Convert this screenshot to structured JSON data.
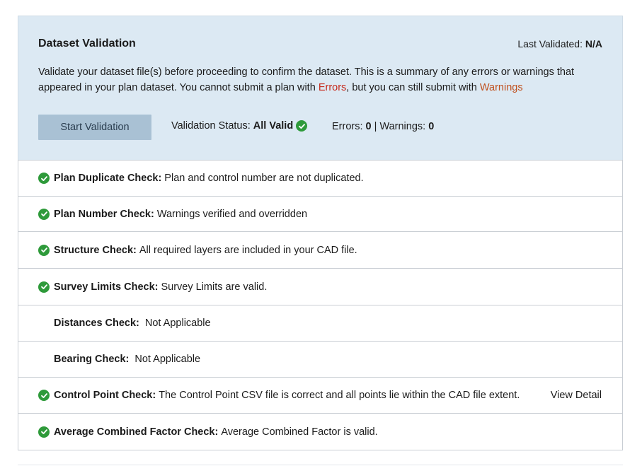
{
  "header": {
    "title": "Dataset Validation",
    "last_validated_label": "Last Validated:",
    "last_validated_value": "N/A",
    "description_part1": "Validate your dataset file(s) before proceeding to confirm the dataset. This is a summary of any errors or warnings that appeared in your plan dataset. You cannot submit a plan with ",
    "description_errors_word": "Errors",
    "description_part2": ", but you can still submit with ",
    "description_warnings_word": "Warnings",
    "start_button_label": "Start Validation",
    "status_label": "Validation Status:",
    "status_value": "All Valid",
    "errors_label": "Errors:",
    "errors_count": "0",
    "separator": "|",
    "warnings_label": "Warnings:",
    "warnings_count": "0"
  },
  "checks": [
    {
      "label": "Plan Duplicate Check:",
      "message": "Plan and control number are not duplicated.",
      "icon": "check-circle-icon"
    },
    {
      "label": "Plan Number Check:",
      "message": "Warnings verified and overridden",
      "icon": "check-circle-icon"
    },
    {
      "label": "Structure Check:",
      "message": "All required layers are included in your CAD file.",
      "icon": "check-circle-icon"
    },
    {
      "label": "Survey Limits Check:",
      "message": "Survey Limits are valid.",
      "icon": "check-circle-icon"
    },
    {
      "label": "Distances Check:",
      "message": "Not Applicable",
      "icon": ""
    },
    {
      "label": "Bearing Check:",
      "message": "Not Applicable",
      "icon": ""
    },
    {
      "label": "Control Point Check:",
      "message": "The Control Point CSV file is correct and all points lie within the CAD file extent.",
      "icon": "check-circle-icon",
      "action": "View Detail"
    },
    {
      "label": "Average Combined Factor Check:",
      "message": "Average Combined Factor is valid.",
      "icon": "check-circle-icon"
    }
  ],
  "colors": {
    "header_bg": "#dce9f3",
    "button_bg": "#a9c1d4",
    "success_green": "#2e9a3a",
    "error_red": "#c62a1c",
    "warning_orange": "#c0511e"
  }
}
